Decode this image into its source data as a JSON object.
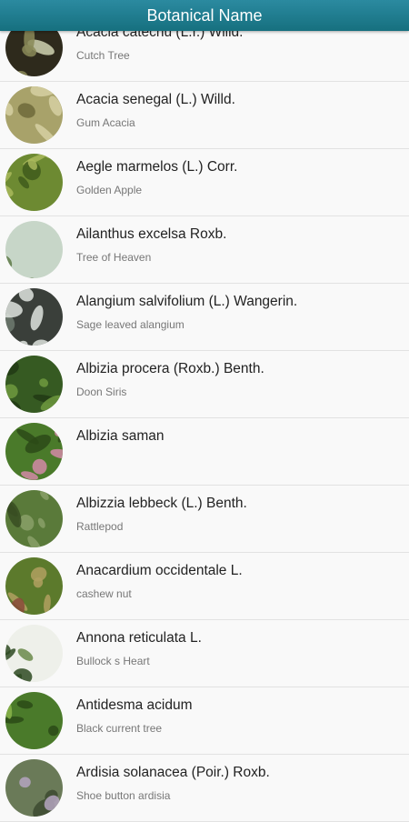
{
  "app_bar": {
    "title": "Botanical Name"
  },
  "colors": {
    "app_bar": "#16707f",
    "title_text": "#ffffff",
    "name_text": "#222222",
    "common_text": "#777777"
  },
  "plants": [
    {
      "botanical": "Acacia catechu (L.f.) Willd.",
      "common": "Cutch Tree",
      "thumb_colors": [
        "#2e2a1c",
        "#8a8a58",
        "#cfd2b0"
      ],
      "thumb_icon": "plant-photo"
    },
    {
      "botanical": "Acacia senegal (L.) Willd.",
      "common": "Gum Acacia",
      "thumb_colors": [
        "#a8a26a",
        "#d6d0a2",
        "#6e6a3a"
      ],
      "thumb_icon": "plant-photo"
    },
    {
      "botanical": "Aegle marmelos (L.) Corr.",
      "common": "Golden Apple",
      "thumb_colors": [
        "#6d8a32",
        "#a9b85c",
        "#3f5a1c"
      ],
      "thumb_icon": "plant-photo"
    },
    {
      "botanical": "Ailanthus excelsa Roxb.",
      "common": "Tree of Heaven",
      "thumb_colors": [
        "#c7d6c8",
        "#5e7a48",
        "#e9eee6"
      ],
      "thumb_icon": "plant-photo"
    },
    {
      "botanical": "Alangium salvifolium (L.) Wangerin.",
      "common": "Sage leaved alangium",
      "thumb_colors": [
        "#3a3f3a",
        "#dfe4df",
        "#6f7a70"
      ],
      "thumb_icon": "plant-photo"
    },
    {
      "botanical": "Albizia procera (Roxb.) Benth.",
      "common": "Doon Siris",
      "thumb_colors": [
        "#365a22",
        "#6e9a3e",
        "#213a14"
      ],
      "thumb_icon": "plant-photo"
    },
    {
      "botanical": "Albizia saman",
      "common": "",
      "thumb_colors": [
        "#4a7a2a",
        "#d28aa6",
        "#2c4a18"
      ],
      "thumb_icon": "plant-photo"
    },
    {
      "botanical": "Albizzia lebbeck (L.) Benth.",
      "common": "Rattlepod",
      "thumb_colors": [
        "#5a7a3a",
        "#8aa068",
        "#384e22"
      ],
      "thumb_icon": "plant-photo"
    },
    {
      "botanical": "Anacardium occidentale L.",
      "common": "cashew nut",
      "thumb_colors": [
        "#5c7a2c",
        "#b0a060",
        "#8a4a3a"
      ],
      "thumb_icon": "plant-photo"
    },
    {
      "botanical": "Annona reticulata L.",
      "common": "Bullock s Heart",
      "thumb_colors": [
        "#eef0ea",
        "#2e4a22",
        "#6a8a4a"
      ],
      "thumb_icon": "plant-photo"
    },
    {
      "botanical": "Antidesma acidum",
      "common": "Black current tree",
      "thumb_colors": [
        "#4a7a2a",
        "#8ab44a",
        "#2a4a16"
      ],
      "thumb_icon": "plant-photo"
    },
    {
      "botanical": "Ardisia solanacea (Poir.) Roxb.",
      "common": "Shoe button ardisia",
      "thumb_colors": [
        "#6a7a58",
        "#b4a4c0",
        "#3c4a30"
      ],
      "thumb_icon": "plant-photo"
    }
  ]
}
